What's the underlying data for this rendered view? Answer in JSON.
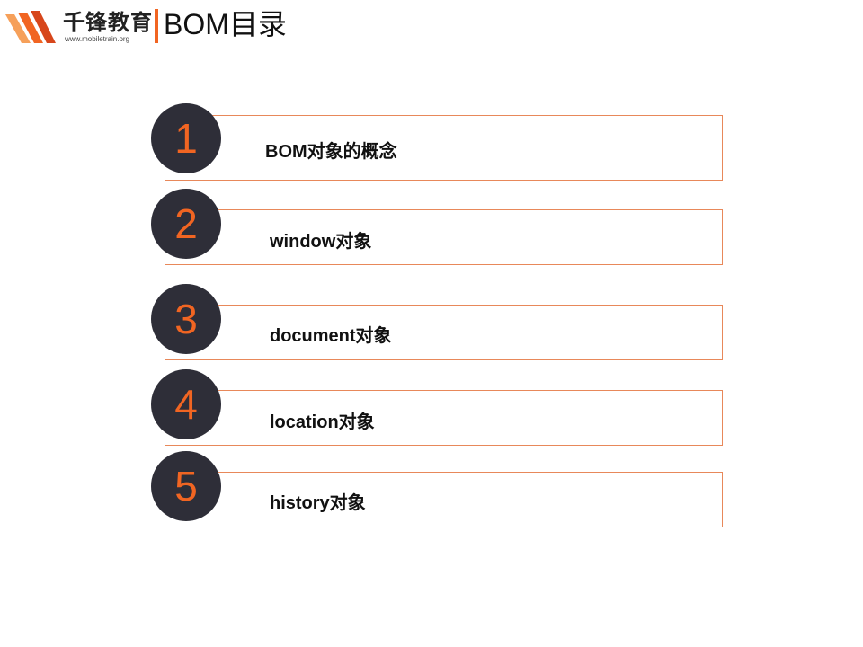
{
  "brand": {
    "name": "千锋教育",
    "url": "www.mobiletrain.org",
    "accent_color": "#f16522"
  },
  "page": {
    "title": "BOM目录"
  },
  "agenda": {
    "items": [
      {
        "number": "1",
        "label": "BOM对象的概念"
      },
      {
        "number": "2",
        "label": "window对象"
      },
      {
        "number": "3",
        "label": "document对象"
      },
      {
        "number": "4",
        "label": "location对象"
      },
      {
        "number": "5",
        "label": "history对象"
      }
    ]
  },
  "colors": {
    "circle": "#2e2e38",
    "number": "#f16522",
    "box_border": "#e8885a"
  }
}
